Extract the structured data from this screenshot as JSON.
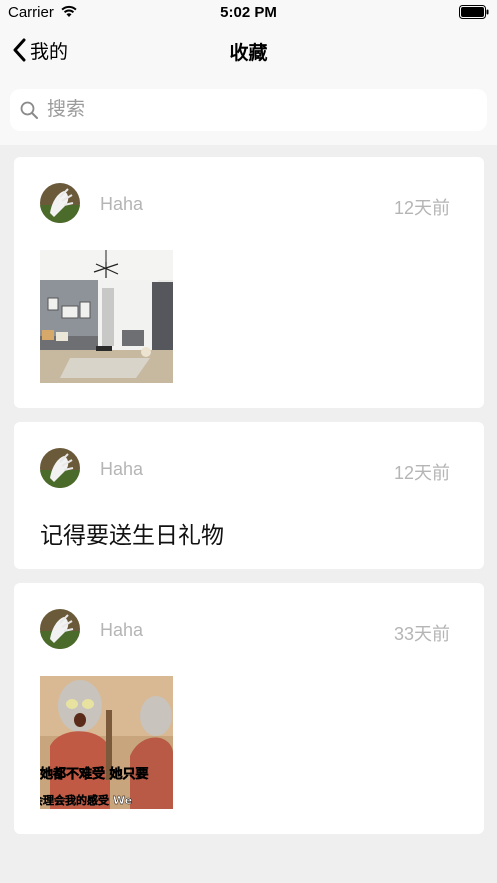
{
  "status_bar": {
    "carrier": "Carrier",
    "time": "5:02 PM",
    "wifi_icon": "wifi-icon",
    "battery_icon": "battery-icon"
  },
  "nav": {
    "back_label": "我的",
    "back_icon": "chevron-left-icon",
    "title": "收藏"
  },
  "search": {
    "placeholder": "搜索",
    "icon": "search-icon"
  },
  "favorites": [
    {
      "username": "Haha",
      "time_ago": "12天前",
      "type": "image",
      "image_icon": "living-room-photo"
    },
    {
      "username": "Haha",
      "time_ago": "12天前",
      "type": "text",
      "text": "记得要送生日礼物"
    },
    {
      "username": "Haha",
      "time_ago": "33天前",
      "type": "image",
      "image_icon": "meme-photo",
      "image_caption_1": "她都不难受 她只要",
      "image_caption_2": "会理会我的感受 We"
    }
  ],
  "colors": {
    "background": "#efefef",
    "card": "#ffffff",
    "muted_text": "#b5b5b5"
  }
}
